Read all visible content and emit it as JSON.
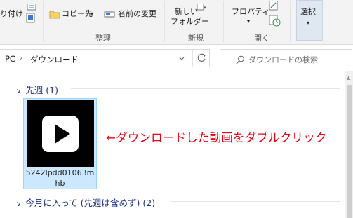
{
  "ribbon": {
    "paste_shortcut_label": "り付け",
    "copy_to_label": "コピー先",
    "rename_label": "名前の変更",
    "organize_group": "整理",
    "new_folder_line1": "新しい",
    "new_folder_line2": "フォルダー",
    "new_group": "新規",
    "properties_label": "プロパティ",
    "open_group": "開く",
    "select_label": "選択"
  },
  "address": {
    "root": "PC",
    "current_folder": "ダウンロード",
    "search_placeholder": "ダウンロードの検索"
  },
  "groups": [
    {
      "label": "先週 (1)"
    },
    {
      "label": "今月に入って (先週は含めず) (2)"
    }
  ],
  "file": {
    "name": "5242lpdd01063mhb"
  },
  "annotation": "←ダウンロードした動画をダブルクリック",
  "colors": {
    "accent_blue": "#1e3287",
    "selection_bg": "#cce8ff",
    "annotation_red": "#e60012"
  }
}
